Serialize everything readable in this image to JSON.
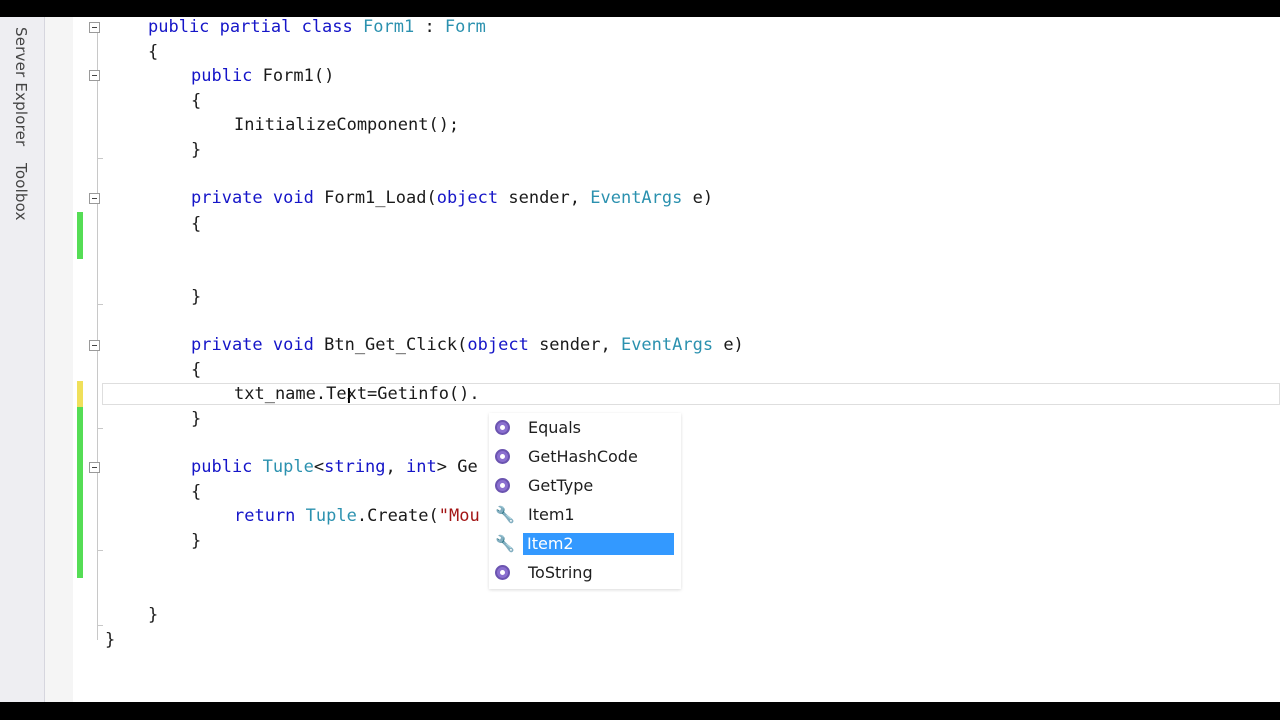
{
  "side_tabs": [
    "Server Explorer",
    "Toolbox"
  ],
  "code": {
    "line1": {
      "k1": "public",
      "k2": "partial",
      "k3": "class",
      "t1": "Form1",
      "sep": " : ",
      "t2": "Form"
    },
    "brace": "{",
    "close": "}",
    "line3": {
      "k1": "public",
      "name": "Form1()"
    },
    "line5": "InitializeComponent();",
    "line8": {
      "k1": "private",
      "k2": "void",
      "name": "Form1_Load(",
      "k3": "object",
      "arg": " sender, ",
      "t1": "EventArgs",
      "end": " e)"
    },
    "line14": {
      "k1": "private",
      "k2": "void",
      "name": "Btn_Get_Click(",
      "k3": "object",
      "arg": " sender, ",
      "t1": "EventArgs",
      "end": " e)"
    },
    "line16": "txt_name.Text=Getinfo().",
    "line19": {
      "k1": "public",
      "t1": "Tuple",
      "lt": "<",
      "k2": "string",
      "comma": ", ",
      "k3": "int",
      "gt": ">",
      "name": " Ge"
    },
    "line21": {
      "k1": "return",
      "t1": "Tuple",
      "call": ".Create(",
      "str": "\"Mou"
    }
  },
  "intellisense": {
    "items": [
      {
        "label": "Equals",
        "icon": "method-icon"
      },
      {
        "label": "GetHashCode",
        "icon": "method-icon"
      },
      {
        "label": "GetType",
        "icon": "method-icon"
      },
      {
        "label": "Item1",
        "icon": "wrench-icon"
      },
      {
        "label": "Item2",
        "icon": "wrench-icon",
        "selected": true
      },
      {
        "label": "ToString",
        "icon": "method-icon"
      }
    ]
  },
  "colors": {
    "keyword": "#1515c8",
    "type": "#2b91af",
    "string": "#a31515",
    "selection": "#3399ff",
    "change_saved": "#55dd55",
    "change_unsaved": "#f0e05a"
  }
}
